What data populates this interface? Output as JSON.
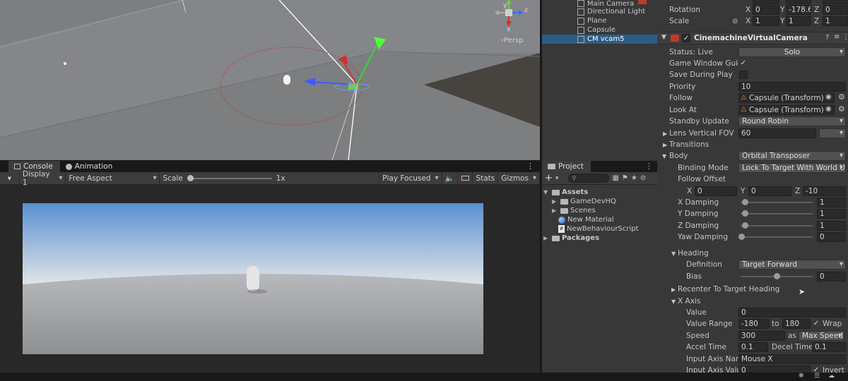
{
  "scene": {
    "persp_label": "‹Persp",
    "gizmo_axes": {
      "y": "y",
      "x": "x",
      "z": "z"
    }
  },
  "game_panel": {
    "tabs": [
      {
        "label": "Console",
        "icon": "console-icon"
      },
      {
        "label": "Animation",
        "icon": "animation-icon"
      }
    ],
    "toolbar": {
      "display": "Display 1",
      "aspect": "Free Aspect",
      "scale_label": "Scale",
      "scale_value": "1x",
      "play_mode": "Play Focused",
      "stats": "Stats",
      "gizmos": "Gizmos"
    }
  },
  "hierarchy": {
    "items": [
      {
        "label": "Main Camera",
        "selected": false
      },
      {
        "label": "Directional Light",
        "selected": false
      },
      {
        "label": "Plane",
        "selected": false
      },
      {
        "label": "Capsule",
        "selected": false
      },
      {
        "label": "CM vcam5",
        "selected": true
      }
    ]
  },
  "project": {
    "tab_label": "Project",
    "add_label": "+",
    "tree": [
      {
        "label": "Assets",
        "level": 0,
        "type": "folder",
        "expanded": true,
        "bold": true
      },
      {
        "label": "GameDevHQ",
        "level": 1,
        "type": "folder"
      },
      {
        "label": "Scenes",
        "level": 1,
        "type": "folder"
      },
      {
        "label": "New Material",
        "level": 1,
        "type": "material"
      },
      {
        "label": "NewBehaviourScript",
        "level": 1,
        "type": "script"
      },
      {
        "label": "Packages",
        "level": 0,
        "type": "folder",
        "bold": true
      }
    ]
  },
  "inspector": {
    "transform": {
      "rotation_label": "Rotation",
      "rotation": {
        "x": "0",
        "y": "-178.6",
        "z": "0"
      },
      "scale_label": "Scale",
      "scale": {
        "x": "1",
        "y": "1",
        "z": "1"
      }
    },
    "component_title": "CinemachineVirtualCamera",
    "status_label": "Status: Live",
    "solo_label": "Solo",
    "game_window_guides_label": "Game Window Guide",
    "save_during_play_label": "Save During Play",
    "priority_label": "Priority",
    "priority": "10",
    "follow_label": "Follow",
    "follow": "Capsule (Transform)",
    "look_at_label": "Look At",
    "look_at": "Capsule (Transform)",
    "standby_label": "Standby Update",
    "standby": "Round Robin",
    "lens_label": "Lens Vertical FOV",
    "lens": "60",
    "transitions_label": "Transitions",
    "body_label": "Body",
    "body": "Orbital Transposer",
    "binding_mode_label": "Binding Mode",
    "binding_mode": "Lock To Target With World U",
    "follow_offset_label": "Follow Offset",
    "follow_offset": {
      "x": "0",
      "y": "0",
      "z": "-10"
    },
    "x_damping_label": "X Damping",
    "x_damping": "1",
    "y_damping_label": "Y Damping",
    "y_damping": "1",
    "z_damping_label": "Z Damping",
    "z_damping": "1",
    "yaw_damping_label": "Yaw Damping",
    "yaw_damping": "0",
    "heading_label": "Heading",
    "definition_label": "Definition",
    "definition": "Target Forward",
    "bias_label": "Bias",
    "bias": "0",
    "recenter_label": "Recenter To Target Heading",
    "x_axis_label": "X Axis",
    "value_label": "Value",
    "value": "0",
    "value_range_label": "Value Range",
    "range_min": "-180",
    "range_to": "to",
    "range_max": "180",
    "wrap_label": "Wrap",
    "speed_label": "Speed",
    "speed": "300",
    "speed_as": "as",
    "speed_mode": "Max Speed",
    "accel_label": "Accel Time",
    "accel": "0.1",
    "decel_label": "Decel Time",
    "decel": "0.1",
    "input_axis_name_label": "Input Axis Name",
    "input_axis_name": "Mouse X",
    "input_axis_value_label": "Input Axis Value",
    "input_axis_value": "0",
    "invert_label": "Invert"
  },
  "colors": {
    "selection": "#2c5d87",
    "panel": "#383838",
    "field": "#2a2a2a"
  }
}
